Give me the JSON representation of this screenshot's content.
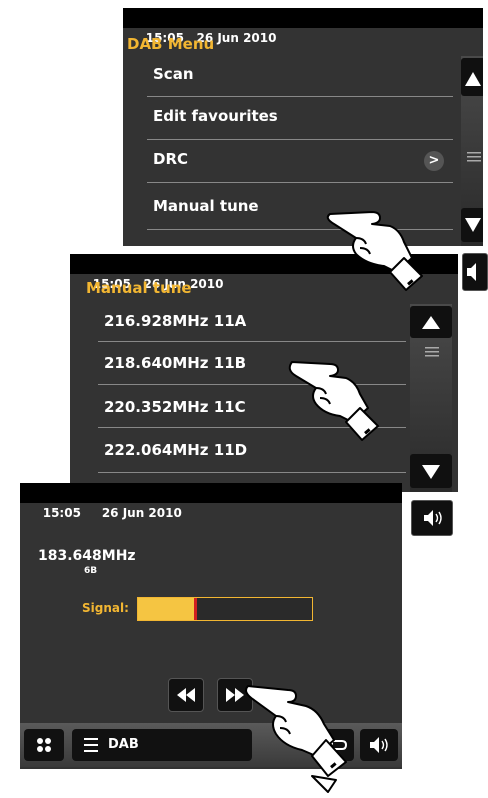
{
  "screen1": {
    "time": "15:05",
    "date": "26 Jun 2010",
    "title": "DAB Menu",
    "items": [
      "Scan",
      "Edit favourites",
      "DRC",
      "Manual tune"
    ],
    "drc_arrow": ">"
  },
  "screen2": {
    "time": "15:05",
    "date": "26 Jun 2010",
    "title": "Manual tune",
    "items": [
      "216.928MHz 11A",
      "218.640MHz 11B",
      "220.352MHz 11C",
      "222.064MHz 11D"
    ]
  },
  "screen3": {
    "time": "15:05",
    "date": "26 Jun 2010",
    "frequency": "183.648MHz",
    "channel": "6B",
    "signal_label": "Signal:",
    "signal_level": 0.33,
    "mode_label": "DAB"
  },
  "colors": {
    "accent": "#f2b632",
    "signal_fill": "#f5c542",
    "signal_marker": "#d02020",
    "screen_bg": "#333333"
  },
  "icons": [
    "scroll-up-icon",
    "scroll-down-icon",
    "scroll-grip-icon",
    "volume-icon",
    "chevron-right-icon",
    "rewind-icon",
    "fast-forward-icon",
    "back-icon",
    "menu-icon",
    "grid-icon",
    "pointing-hand-icon"
  ]
}
